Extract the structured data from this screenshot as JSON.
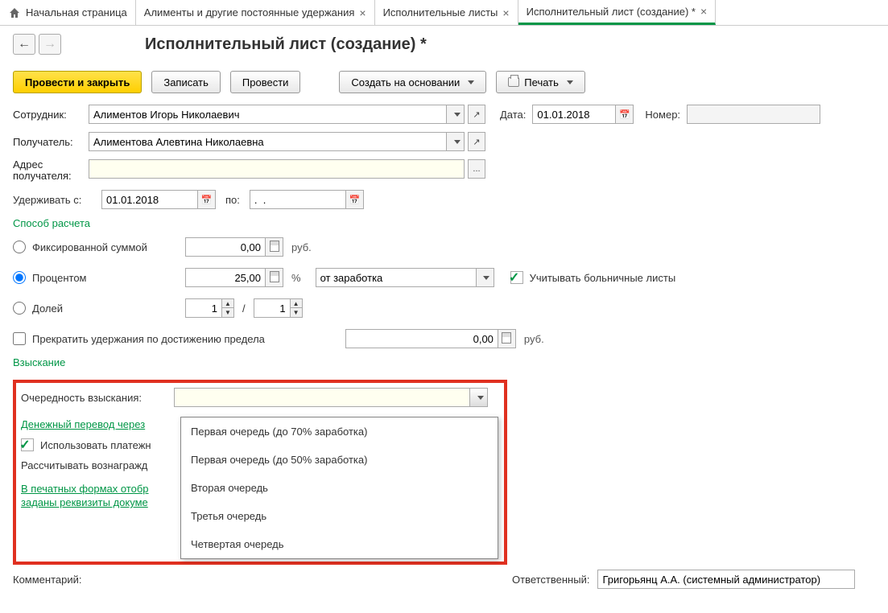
{
  "tabs": {
    "home": "Начальная страница",
    "t1": "Алименты и другие постоянные удержания",
    "t2": "Исполнительные листы",
    "t3": "Исполнительный лист (создание) *"
  },
  "title": "Исполнительный лист (создание) *",
  "buttons": {
    "post_close": "Провести и закрыть",
    "save": "Записать",
    "post": "Провести",
    "create_based": "Создать на основании",
    "print": "Печать"
  },
  "labels": {
    "employee": "Сотрудник:",
    "date": "Дата:",
    "number": "Номер:",
    "recipient": "Получатель:",
    "recipient_addr1": "Адрес",
    "recipient_addr2": "получателя:",
    "withhold_from": "Удерживать с:",
    "to": "по:",
    "calc_method": "Способ расчета",
    "fixed": "Фиксированной суммой",
    "percent": "Процентом",
    "fraction": "Долей",
    "rub": "руб.",
    "from_earnings": "от заработка",
    "include_sick": "Учитывать больничные листы",
    "stop_limit": "Прекратить удержания по достижению предела",
    "collection": "Взыскание",
    "priority": "Очередность взыскания:",
    "money_transfer": "Денежный перевод через",
    "use_payment_agent": "Использовать платежн",
    "calc_reward": "Рассчитывать вознагражд",
    "print_forms_line": "В печатных формах отобр",
    "print_forms_line2": "заданы реквизиты докуме",
    "comment": "Комментарий:",
    "responsible": "Ответственный:",
    "pct": "%",
    "slash": "/",
    "ellipsis": "..."
  },
  "values": {
    "employee": "Алиментов Игорь Николаевич",
    "date": "01.01.2018",
    "number": "",
    "recipient": "Алиментова Алевтина Николаевна",
    "addr": "",
    "from_date": "01.01.2018",
    "to_date": ".  .",
    "fixed_sum": "0,00",
    "percent": "25,00",
    "fraction_num": "1",
    "fraction_den": "1",
    "limit": "0,00",
    "priority": "",
    "responsible": "Григорьянц А.А. (системный администратор)"
  },
  "dropdown": {
    "o1": "Первая очередь (до 70% заработка)",
    "o2": "Первая очередь (до 50% заработка)",
    "o3": "Вторая очередь",
    "o4": "Третья очередь",
    "o5": "Четвертая очередь"
  }
}
